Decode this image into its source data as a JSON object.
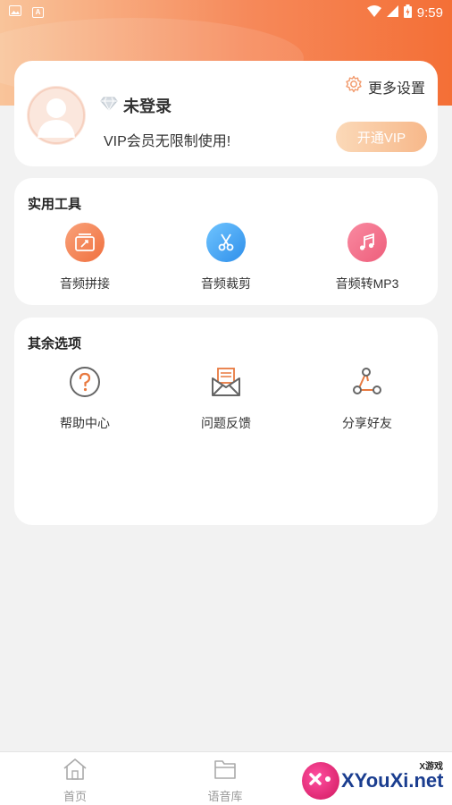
{
  "status_bar": {
    "time": "9:59"
  },
  "profile": {
    "login_text": "未登录",
    "vip_desc": "VIP会员无限制使用!",
    "settings_label": "更多设置",
    "vip_button": "开通VIP"
  },
  "tools": {
    "title": "实用工具",
    "items": [
      {
        "label": "音频拼接",
        "icon": "audio-merge-icon"
      },
      {
        "label": "音频裁剪",
        "icon": "scissors-icon"
      },
      {
        "label": "音频转MP3",
        "icon": "music-note-icon"
      }
    ]
  },
  "others": {
    "title": "其余选项",
    "items": [
      {
        "label": "帮助中心",
        "icon": "question-icon"
      },
      {
        "label": "问题反馈",
        "icon": "envelope-icon"
      },
      {
        "label": "分享好友",
        "icon": "share-icon"
      }
    ]
  },
  "bottom_nav": {
    "items": [
      {
        "label": "首页",
        "icon": "home-icon"
      },
      {
        "label": "语音库",
        "icon": "folder-icon"
      }
    ]
  },
  "watermark": {
    "small": "X游戏",
    "big": "XYouXi.net"
  },
  "colors": {
    "accent": "#f46f36",
    "vip_gradient_start": "#fbd9b8",
    "vip_gradient_end": "#f7b88a",
    "icon_line": "#e8793f"
  }
}
